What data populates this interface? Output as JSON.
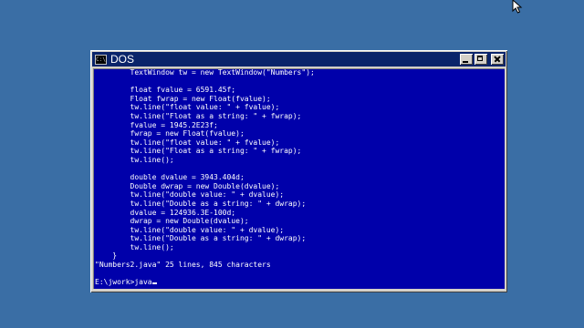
{
  "window": {
    "title": "DOS",
    "icon_label": "C:\\"
  },
  "title_buttons": {
    "minimize": "minimize-icon",
    "maximize": "maximize-icon",
    "close": "close-icon"
  },
  "console": {
    "lines": [
      "        TextWindow tw = new TextWindow(\"Numbers\");",
      "",
      "        float fvalue = 6591.45f;",
      "        Float fwrap = new Float(fvalue);",
      "        tw.line(\"float value: \" + fvalue);",
      "        tw.line(\"Float as a string: \" + fwrap);",
      "        fvalue = 1945.2E23f;",
      "        fwrap = new Float(fvalue);",
      "        tw.line(\"float value: \" + fvalue);",
      "        tw.line(\"Float as a string: \" + fwrap);",
      "        tw.line();",
      "",
      "        double dvalue = 3943.404d;",
      "        Double dwrap = new Double(dvalue);",
      "        tw.line(\"double value: \" + dvalue);",
      "        tw.line(\"Double as a string: \" + dwrap);",
      "        dvalue = 124936.3E-100d;",
      "        dwrap = new Double(dvalue);",
      "        tw.line(\"double value: \" + dvalue);",
      "        tw.line(\"Double as a string: \" + dwrap);",
      "        tw.line();",
      "    }",
      "\"Numbers2.java\" 25 lines, 845 characters",
      "",
      "E:\\jwork>java"
    ]
  }
}
